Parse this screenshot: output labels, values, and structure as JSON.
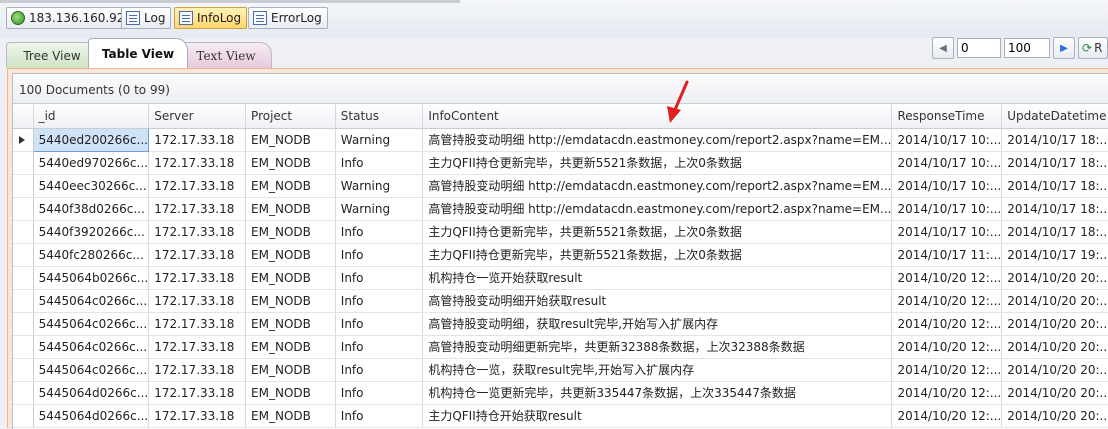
{
  "toolbar": {
    "server": "183.136.160.92",
    "log": "Log",
    "infolog": "InfoLog",
    "errorlog": "ErrorLog"
  },
  "tabs": {
    "tree": "Tree View",
    "table": "Table View",
    "text": "Text View"
  },
  "pager": {
    "skip": "0",
    "limit": "100",
    "refresh_label": "R"
  },
  "grid": {
    "count_label": "100 Documents (0 to 99)",
    "columns": [
      "_id",
      "Server",
      "Project",
      "Status",
      "InfoContent",
      "ResponseTime",
      "UpdateDatetime"
    ],
    "rows": [
      {
        "id": "5440ed200266c...",
        "server": "172.17.33.18",
        "project": "EM_NODB",
        "status": "Warning",
        "content": "高管持股变动明细 http://emdatacdn.eastmoney.com/report2.aspx?name=EM...",
        "response": "2014/10/17 10:...",
        "update": "2014/10/17 18:..."
      },
      {
        "id": "5440ed970266c...",
        "server": "172.17.33.18",
        "project": "EM_NODB",
        "status": "Info",
        "content": "主力QFII持仓更新完毕，共更新5521条数据，上次0条数据",
        "response": "2014/10/17 10:...",
        "update": "2014/10/17 18:..."
      },
      {
        "id": "5440eec30266c...",
        "server": "172.17.33.18",
        "project": "EM_NODB",
        "status": "Warning",
        "content": "高管持股变动明细 http://emdatacdn.eastmoney.com/report2.aspx?name=EM...",
        "response": "2014/10/17 10:...",
        "update": "2014/10/17 18:..."
      },
      {
        "id": "5440f38d0266c...",
        "server": "172.17.33.18",
        "project": "EM_NODB",
        "status": "Warning",
        "content": "高管持股变动明细 http://emdatacdn.eastmoney.com/report2.aspx?name=EM...",
        "response": "2014/10/17 10:...",
        "update": "2014/10/17 18:..."
      },
      {
        "id": "5440f3920266c...",
        "server": "172.17.33.18",
        "project": "EM_NODB",
        "status": "Info",
        "content": "主力QFII持仓更新完毕，共更新5521条数据，上次0条数据",
        "response": "2014/10/17 10:...",
        "update": "2014/10/17 18:..."
      },
      {
        "id": "5440fc280266c...",
        "server": "172.17.33.18",
        "project": "EM_NODB",
        "status": "Info",
        "content": "主力QFII持仓更新完毕，共更新5521条数据，上次0条数据",
        "response": "2014/10/17 11:...",
        "update": "2014/10/17 19:..."
      },
      {
        "id": "5445064b0266c...",
        "server": "172.17.33.18",
        "project": "EM_NODB",
        "status": "Info",
        "content": "机构持仓一览开始获取result",
        "response": "2014/10/20 12:...",
        "update": "2014/10/20 20:..."
      },
      {
        "id": "5445064c0266c...",
        "server": "172.17.33.18",
        "project": "EM_NODB",
        "status": "Info",
        "content": "高管持股变动明细开始获取result",
        "response": "2014/10/20 12:...",
        "update": "2014/10/20 20:..."
      },
      {
        "id": "5445064c0266c...",
        "server": "172.17.33.18",
        "project": "EM_NODB",
        "status": "Info",
        "content": "高管持股变动明细，获取result完毕,开始写入扩展内存",
        "response": "2014/10/20 12:...",
        "update": "2014/10/20 20:..."
      },
      {
        "id": "5445064c0266c...",
        "server": "172.17.33.18",
        "project": "EM_NODB",
        "status": "Info",
        "content": "高管持股变动明细更新完毕，共更新32388条数据，上次32388条数据",
        "response": "2014/10/20 12:...",
        "update": "2014/10/20 20:..."
      },
      {
        "id": "5445064c0266c...",
        "server": "172.17.33.18",
        "project": "EM_NODB",
        "status": "Info",
        "content": "机构持仓一览，获取result完毕,开始写入扩展内存",
        "response": "2014/10/20 12:...",
        "update": "2014/10/20 20:..."
      },
      {
        "id": "5445064d0266c...",
        "server": "172.17.33.18",
        "project": "EM_NODB",
        "status": "Info",
        "content": "机构持仓一览更新完毕，共更新335447条数据，上次335447条数据",
        "response": "2014/10/20 12:...",
        "update": "2014/10/20 20:..."
      },
      {
        "id": "5445064d0266c...",
        "server": "172.17.33.18",
        "project": "EM_NODB",
        "status": "Info",
        "content": "主力QFII持仓开始获取result",
        "response": "2014/10/20 12:...",
        "update": "2014/10/20 20:..."
      }
    ]
  },
  "colors": {
    "selected_tab_border": "#f0b68a",
    "arrow": "#e01f1f"
  }
}
